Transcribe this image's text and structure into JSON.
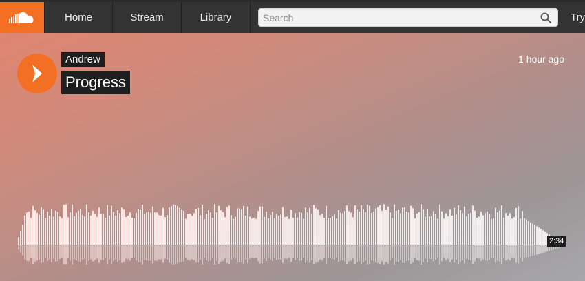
{
  "header": {
    "logo_icon": "soundcloud-logo",
    "nav": [
      {
        "label": "Home"
      },
      {
        "label": "Stream"
      },
      {
        "label": "Library"
      }
    ],
    "search": {
      "placeholder": "Search",
      "value": "",
      "icon": "search-icon"
    },
    "try_label": "Try"
  },
  "track": {
    "artist": "Andrew",
    "title": "Progress",
    "posted": "1 hour ago",
    "duration": "2:34",
    "play_icon": "play-icon",
    "progress": 0
  },
  "colors": {
    "brand": "#f26f23",
    "topbar": "#333333",
    "label_bg": "#1e1e1e",
    "gradient_start": "#e08672",
    "gradient_end": "#a7a7a9"
  }
}
